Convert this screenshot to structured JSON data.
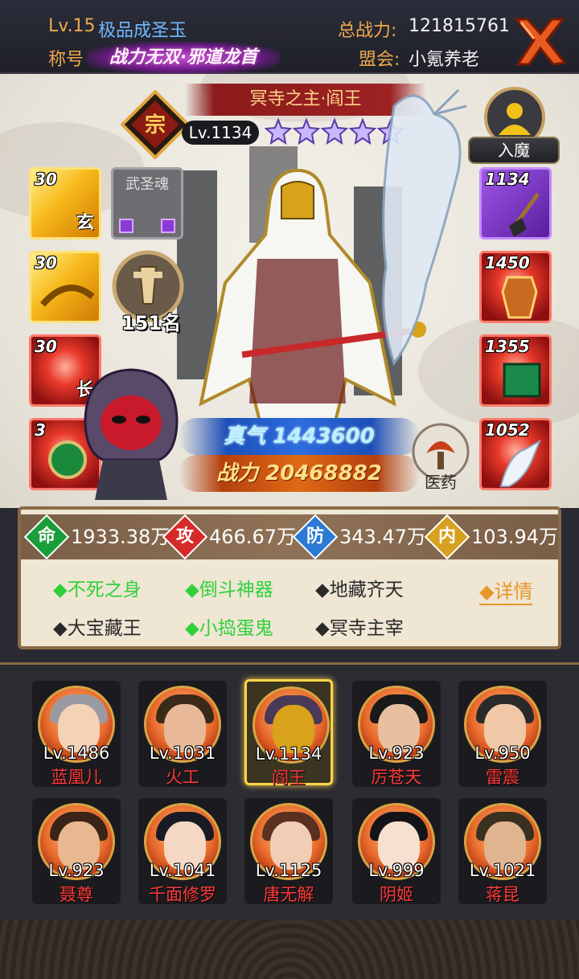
{
  "header": {
    "level_title": "Lv.15极品成圣玉",
    "title_prefix": "称号",
    "title_badge": "战力无双·邪道龙首",
    "power_label": "总战力:",
    "power_value": "121815761",
    "guild_label": "盟会:",
    "guild_value": "小氪养老",
    "colors": {
      "orange": "#f0a94a",
      "blue": "#6fb9ff"
    }
  },
  "hero": {
    "name": "冥寺之主·阎王",
    "level": "Lv.1134",
    "stars": 5,
    "rank_text": "151名",
    "rumo_label": "入魔",
    "qi": "真气 1443600",
    "power": "战力 20468882",
    "medicine_label": "医药"
  },
  "left_slots": [
    {
      "num": "30",
      "tag": "玄",
      "style": "gold"
    },
    {
      "num": "",
      "label": "武圣魂",
      "style": "gray"
    },
    {
      "num": "30",
      "tag": "",
      "style": "gold"
    },
    {
      "num": "30",
      "tag": "长",
      "style": "red"
    },
    {
      "num": "3",
      "tag": "",
      "style": "red"
    }
  ],
  "right_slots": [
    {
      "num": "1134",
      "style": "purple",
      "icon": "shovel-icon"
    },
    {
      "num": "1450",
      "style": "red",
      "icon": "armor-icon"
    },
    {
      "num": "1355",
      "style": "red",
      "icon": "book-icon"
    },
    {
      "num": "1052",
      "style": "red",
      "icon": "beast-icon"
    }
  ],
  "attributes": [
    {
      "label": "命",
      "value": "1933.38万",
      "color": "#1a9e3a"
    },
    {
      "label": "攻",
      "value": "466.67万",
      "color": "#d62a2a"
    },
    {
      "label": "防",
      "value": "343.47万",
      "color": "#2a7ad6"
    },
    {
      "label": "内",
      "value": "103.94万",
      "color": "#d8a020"
    }
  ],
  "buffs": [
    {
      "text": "◆不死之身",
      "active": true
    },
    {
      "text": "◆倒斗神器",
      "active": true
    },
    {
      "text": "◆地藏齐天",
      "active": false
    },
    {
      "text": "◆大宝藏王",
      "active": false
    },
    {
      "text": "◆小捣蛋鬼",
      "active": true
    },
    {
      "text": "◆冥寺主宰",
      "active": false
    }
  ],
  "detail_link": "◆详情",
  "roster": [
    {
      "level": "Lv.1486",
      "name": "蓝凰儿",
      "selected": false
    },
    {
      "level": "Lv.1031",
      "name": "火工",
      "selected": false
    },
    {
      "level": "Lv.1134",
      "name": "阎王",
      "selected": true
    },
    {
      "level": "Lv.923",
      "name": "厉苍天",
      "selected": false
    },
    {
      "level": "Lv.950",
      "name": "雷震",
      "selected": false
    },
    {
      "level": "Lv.923",
      "name": "聂尊",
      "selected": false
    },
    {
      "level": "Lv.1041",
      "name": "千面修罗",
      "selected": false
    },
    {
      "level": "Lv.1125",
      "name": "唐无解",
      "selected": false
    },
    {
      "level": "Lv.999",
      "name": "阴姬",
      "selected": false
    },
    {
      "level": "Lv.1021",
      "name": "蒋昆",
      "selected": false
    }
  ]
}
